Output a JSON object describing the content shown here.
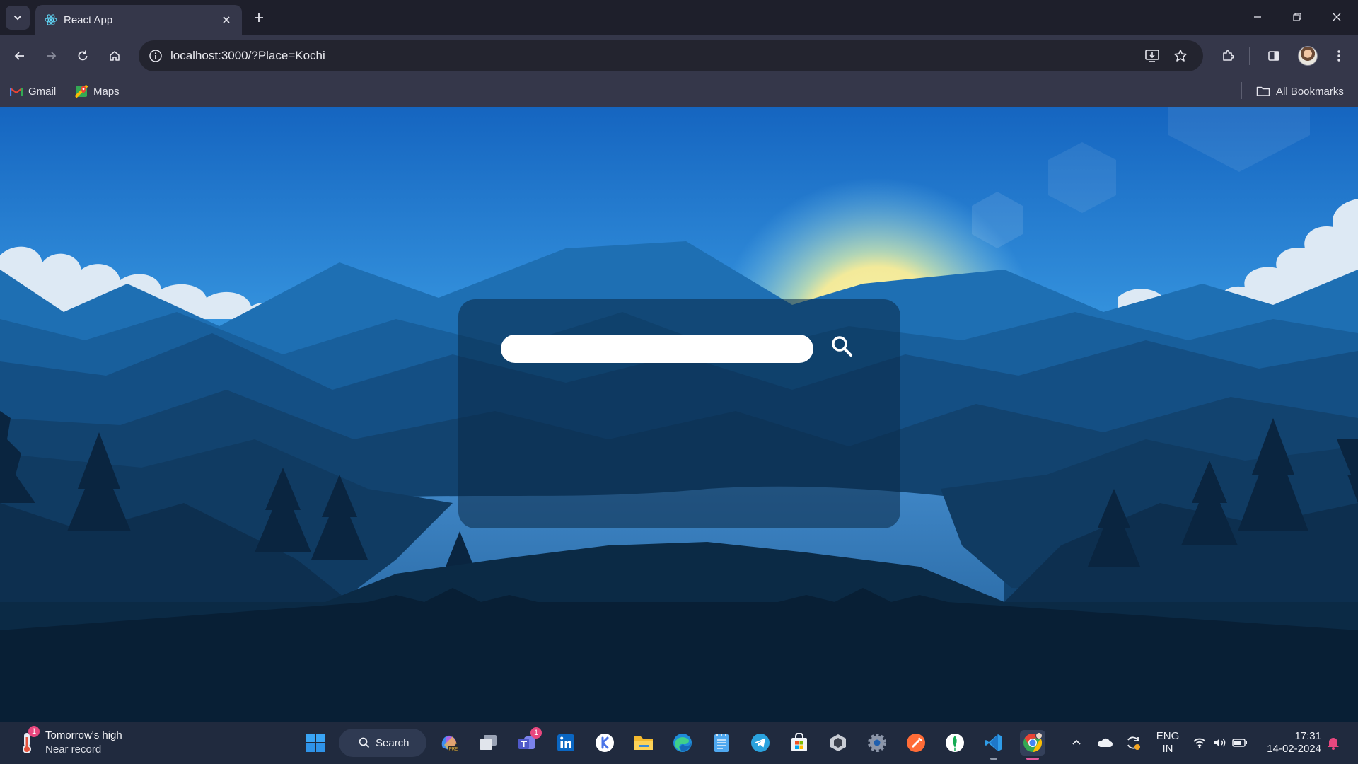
{
  "browser": {
    "tab": {
      "title": "React App",
      "favicon": "react-icon"
    },
    "address_bar": {
      "url": "localhost:3000/?Place=Kochi"
    },
    "bookmarks": [
      {
        "label": "Gmail",
        "icon": "gmail-icon"
      },
      {
        "label": "Maps",
        "icon": "maps-icon"
      }
    ],
    "all_bookmarks_label": "All Bookmarks"
  },
  "weather_app": {
    "search": {
      "value": "",
      "placeholder": ""
    },
    "search_button_icon": "search-icon"
  },
  "taskbar": {
    "weather_widget": {
      "line1": "Tomorrow's high",
      "line2": "Near record",
      "badge": "1"
    },
    "search_label": "Search",
    "apps": [
      {
        "name": "start",
        "icon": "windows-start-icon"
      },
      {
        "name": "copilot",
        "icon": "copilot-icon"
      },
      {
        "name": "task-view",
        "icon": "task-view-icon"
      },
      {
        "name": "teams",
        "icon": "teams-icon",
        "badge": "1"
      },
      {
        "name": "linkedin",
        "icon": "linkedin-icon"
      },
      {
        "name": "app-k",
        "icon": "app-k-icon"
      },
      {
        "name": "file-explorer",
        "icon": "folder-icon"
      },
      {
        "name": "edge",
        "icon": "edge-icon"
      },
      {
        "name": "notepad",
        "icon": "notepad-icon"
      },
      {
        "name": "telegram",
        "icon": "telegram-icon"
      },
      {
        "name": "store",
        "icon": "store-icon"
      },
      {
        "name": "unity",
        "icon": "unity-icon"
      },
      {
        "name": "settings",
        "icon": "settings-icon"
      },
      {
        "name": "postman",
        "icon": "postman-icon"
      },
      {
        "name": "mongodb-compass",
        "icon": "mongodb-icon"
      },
      {
        "name": "vscode",
        "icon": "vscode-icon"
      },
      {
        "name": "chrome",
        "icon": "chrome-icon"
      }
    ],
    "tray": {
      "language_line1": "ENG",
      "language_line2": "IN",
      "time": "17:31",
      "date": "14-02-2024"
    }
  },
  "colors": {
    "chrome_dark": "#1e1f2b",
    "chrome_toolbar": "#35374a",
    "taskbar": "#202a3e",
    "sky_top": "#1565c0",
    "sky_bottom": "#5ec1f0",
    "sun": "#f3ea9a"
  }
}
